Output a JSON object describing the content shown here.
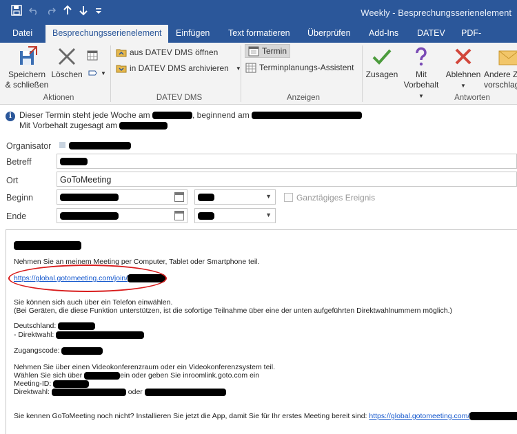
{
  "window": {
    "title": "Weekly - Besprechungsserienelement"
  },
  "qat": {
    "save_icon": "save-icon",
    "undo_icon": "undo-icon",
    "redo_icon": "redo-icon",
    "up_icon": "up-arrow-icon",
    "down_icon": "down-arrow-icon",
    "more_icon": "customize-icon"
  },
  "tabs": [
    {
      "label": "Datei"
    },
    {
      "label": "Besprechungsserienelement"
    },
    {
      "label": "Einfügen"
    },
    {
      "label": "Text formatieren"
    },
    {
      "label": "Überprüfen"
    },
    {
      "label": "Add-Ins"
    },
    {
      "label": "DATEV"
    },
    {
      "label": "PDF-XChange"
    }
  ],
  "ribbon": {
    "aktionen": {
      "label": "Aktionen",
      "save_close_line1": "Speichern",
      "save_close_line2": "& schließen",
      "delete": "Löschen"
    },
    "datev_dms": {
      "label": "DATEV DMS",
      "open": "aus DATEV DMS öffnen",
      "archive": "in DATEV DMS archivieren"
    },
    "anzeigen": {
      "label": "Anzeigen",
      "termin": "Termin",
      "assistant": "Terminplanungs-Assistent"
    },
    "antworten": {
      "label": "Antworten",
      "accept": "Zusagen",
      "tentative_line1": "Mit",
      "tentative_line2": "Vorbehalt",
      "decline": "Ablehnen",
      "propose_line1": "Andere Z",
      "propose_line2": "vorschlag"
    }
  },
  "infobar": {
    "line1_a": "Dieser Termin steht jede Woche am",
    "line1_b": ", beginnend am",
    "line2": "Mit Vorbehalt zugesagt am"
  },
  "form": {
    "organizer_label": "Organisator",
    "subject_label": "Betreff",
    "location_label": "Ort",
    "location_value": "GoToMeeting",
    "start_label": "Beginn",
    "end_label": "Ende",
    "allday_label": "Ganztägiges Ereignis"
  },
  "body": {
    "join_intro": "Nehmen Sie an meinem Meeting per Computer, Tablet oder Smartphone teil.",
    "join_link": "https://global.gotomeeting.com/join/",
    "phone_intro": "Sie können sich auch über ein Telefon einwählen.",
    "phone_note": "(Bei Geräten, die diese Funktion unterstützen, ist die sofortige Teilnahme über eine der unten aufgeführten Direktwahlnummern möglich.)",
    "country": "Deutschland:",
    "direct": "- Direktwahl:",
    "access_code": "Zugangscode:",
    "video_intro": "Nehmen Sie über einen Videokonferenzraum oder ein Videokonferenzsystem teil.",
    "video_dial_a": "Wählen Sie sich über",
    "video_dial_b": "ein oder geben Sie inroomlink.goto.com ein",
    "meeting_id": "Meeting-ID:",
    "direct_dial": "Direktwahl:",
    "or": "oder",
    "app_prompt": "Sie kennen GoToMeeting noch nicht? Installieren Sie jetzt die App, damit Sie für Ihr erstes Meeting bereit sind:",
    "app_link": "https://global.gotomeeting.com/"
  }
}
